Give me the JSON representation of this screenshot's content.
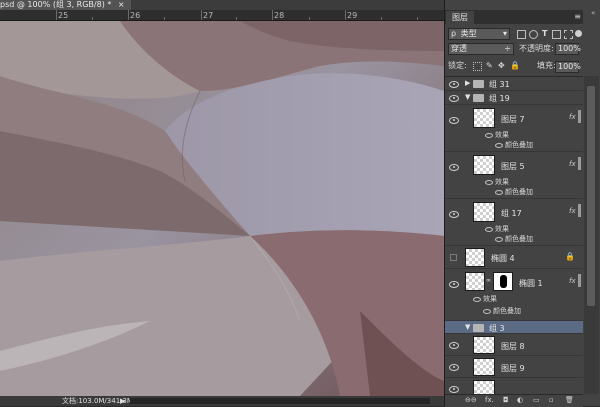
{
  "document": {
    "tab_title": "psd @ 100% (组 3, RGB/8) *",
    "tab_close": "×"
  },
  "ruler": {
    "labels": [
      "25",
      "26",
      "27",
      "28",
      "29"
    ]
  },
  "status_bar": {
    "doc_info": "文档:103.0M/341.3M",
    "arrow": "▶"
  },
  "panel": {
    "tab_label": "图层",
    "menu_icon": "≡",
    "close_icon": "«",
    "filter": {
      "search_icon": "ρ",
      "kind": "类型"
    },
    "blend_mode": "穿透",
    "opacity_label": "不透明度:",
    "opacity_value": "100%",
    "lock_label": "锁定:",
    "fill_label": "填充:",
    "fill_value": "100%",
    "layers": [
      {
        "name": "组 31"
      },
      {
        "name": "组 19"
      },
      {
        "name": "图层 7",
        "effects_label": "效果",
        "effect": "颜色叠加"
      },
      {
        "name": "图层 5",
        "effects_label": "效果",
        "effect": "颜色叠加"
      },
      {
        "name": "组 17",
        "effects_label": "效果",
        "effect": "颜色叠加"
      },
      {
        "name": "椭圆 4"
      },
      {
        "name": "椭圆 1",
        "effects_label": "效果",
        "effect": "颜色叠加"
      },
      {
        "name": "组 3"
      },
      {
        "name": "图层 8"
      },
      {
        "name": "图层 9"
      }
    ],
    "bottom_icons": {
      "link": "⊖⊖",
      "fx": "fx.",
      "mask": "◘",
      "adjust": "◐",
      "group": "▭",
      "new": "▫",
      "delete": "🗑"
    },
    "fx_label": "fx"
  }
}
